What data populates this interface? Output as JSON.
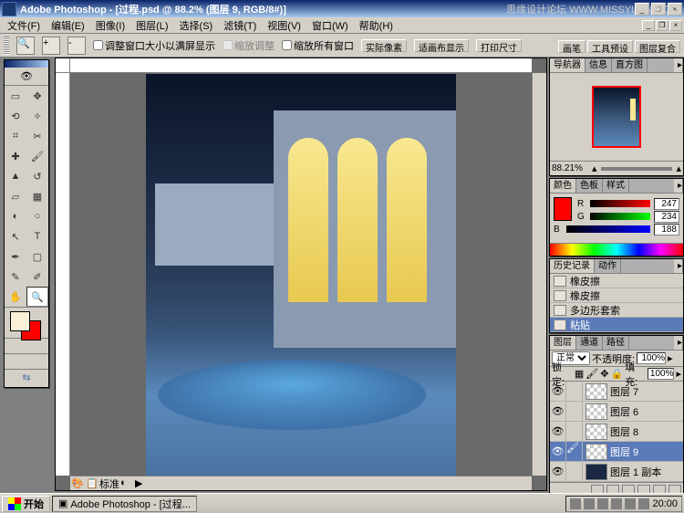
{
  "app": {
    "name": "Adobe Photoshop",
    "doc_title": "[过程.psd @ 88.2% (图层 9, RGB/8#)]"
  },
  "watermark": "思缘设计论坛 WWW.MISSYUAN.COM",
  "menu": {
    "file": "文件(F)",
    "edit": "编辑(E)",
    "image": "图像(I)",
    "layer": "图层(L)",
    "select": "选择(S)",
    "filter": "滤镜(T)",
    "view": "视图(V)",
    "window": "窗口(W)",
    "help": "帮助(H)"
  },
  "options": {
    "fit_window": "调整窗口大小以满屏显示",
    "zoom_rubber": "缩放调整",
    "zoom_all": "缩放所有窗口",
    "actual": "实际像素",
    "fit_screen": "适画布显示",
    "print_size": "打印尺寸"
  },
  "palette_well": {
    "brushes": "画笔",
    "tool_presets": "工具预设",
    "layer_comps": "图层复合"
  },
  "canvas": {
    "zoom_status": "标准"
  },
  "navigator": {
    "tab1": "导航器",
    "tab2": "信息",
    "tab3": "直方图",
    "zoom": "88.21%"
  },
  "color": {
    "tab1": "颜色",
    "tab2": "色板",
    "tab3": "样式",
    "r_label": "R",
    "g_label": "G",
    "b_label": "B",
    "r": "247",
    "g": "234",
    "b": "188"
  },
  "history": {
    "tab1": "历史记录",
    "tab2": "动作",
    "items": [
      "橡皮擦",
      "橡皮擦",
      "多边形套索",
      "粘贴"
    ]
  },
  "layers": {
    "tab1": "图层",
    "tab2": "通道",
    "tab3": "路径",
    "blend": "正常",
    "opacity_label": "不透明度:",
    "opacity": "100%",
    "lock_label": "锁定:",
    "fill_label": "填充:",
    "fill": "100%",
    "items": [
      "图层 7",
      "图层 6",
      "图层 8",
      "图层 9",
      "图层 1 副本"
    ]
  },
  "taskbar": {
    "start": "开始",
    "task1": "Adobe Photoshop - [过程...",
    "clock": "20:00"
  }
}
